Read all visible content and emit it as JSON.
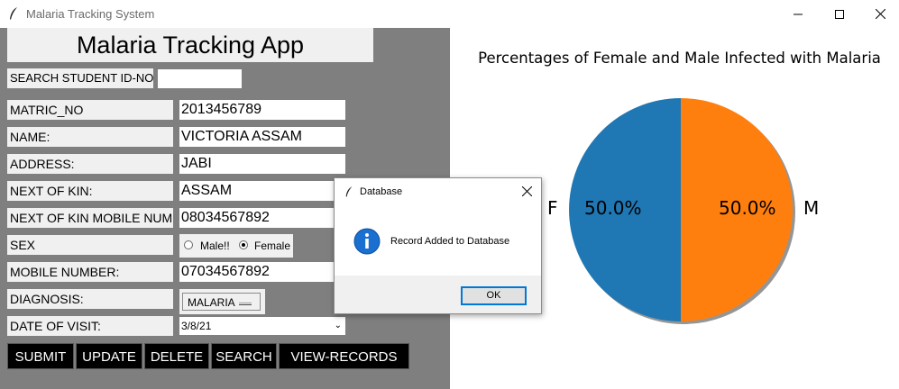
{
  "window": {
    "title": "Malaria Tracking System"
  },
  "app": {
    "title": "Malaria Tracking App"
  },
  "search": {
    "label": "SEARCH STUDENT ID-NO",
    "value": ""
  },
  "fields": [
    {
      "label": "MATRIC_NO",
      "value": "2013456789"
    },
    {
      "label": "NAME:",
      "value": "VICTORIA ASSAM"
    },
    {
      "label": "ADDRESS:",
      "value": "JABI"
    },
    {
      "label": "NEXT OF KIN:",
      "value": "ASSAM"
    },
    {
      "label": "NEXT OF KIN MOBILE NUMBER:",
      "value": "08034567892"
    }
  ],
  "sex": {
    "label": "SEX",
    "options": [
      "Male!!",
      "Female"
    ],
    "selected": "Female"
  },
  "mobile": {
    "label": "MOBILE NUMBER:",
    "value": "07034567892"
  },
  "diagnosis": {
    "label": "DIAGNOSIS:",
    "value": "MALARIA"
  },
  "date_of_visit": {
    "label": "DATE OF VISIT:",
    "value": "3/8/21"
  },
  "buttons": {
    "submit": "SUBMIT",
    "update": "UPDATE",
    "delete": "DELETE",
    "search": "SEARCH",
    "view_records": "VIEW-RECORDS"
  },
  "chart_data": {
    "type": "pie",
    "title": "Percentages of Female and Male Infected with Malaria",
    "categories": [
      "F",
      "M"
    ],
    "values": [
      50.0,
      50.0
    ],
    "labels": [
      "50.0%",
      "50.0%"
    ],
    "colors": [
      "#1f77b4",
      "#ff7f0e"
    ]
  },
  "dialog": {
    "title": "Database",
    "message": "Record Added to Database",
    "ok": "OK",
    "icon": "info-icon"
  },
  "colors": {
    "panel": "#7f7f7f",
    "button_bg": "#000000",
    "button_fg": "#ffffff",
    "accent": "#0078d7"
  }
}
